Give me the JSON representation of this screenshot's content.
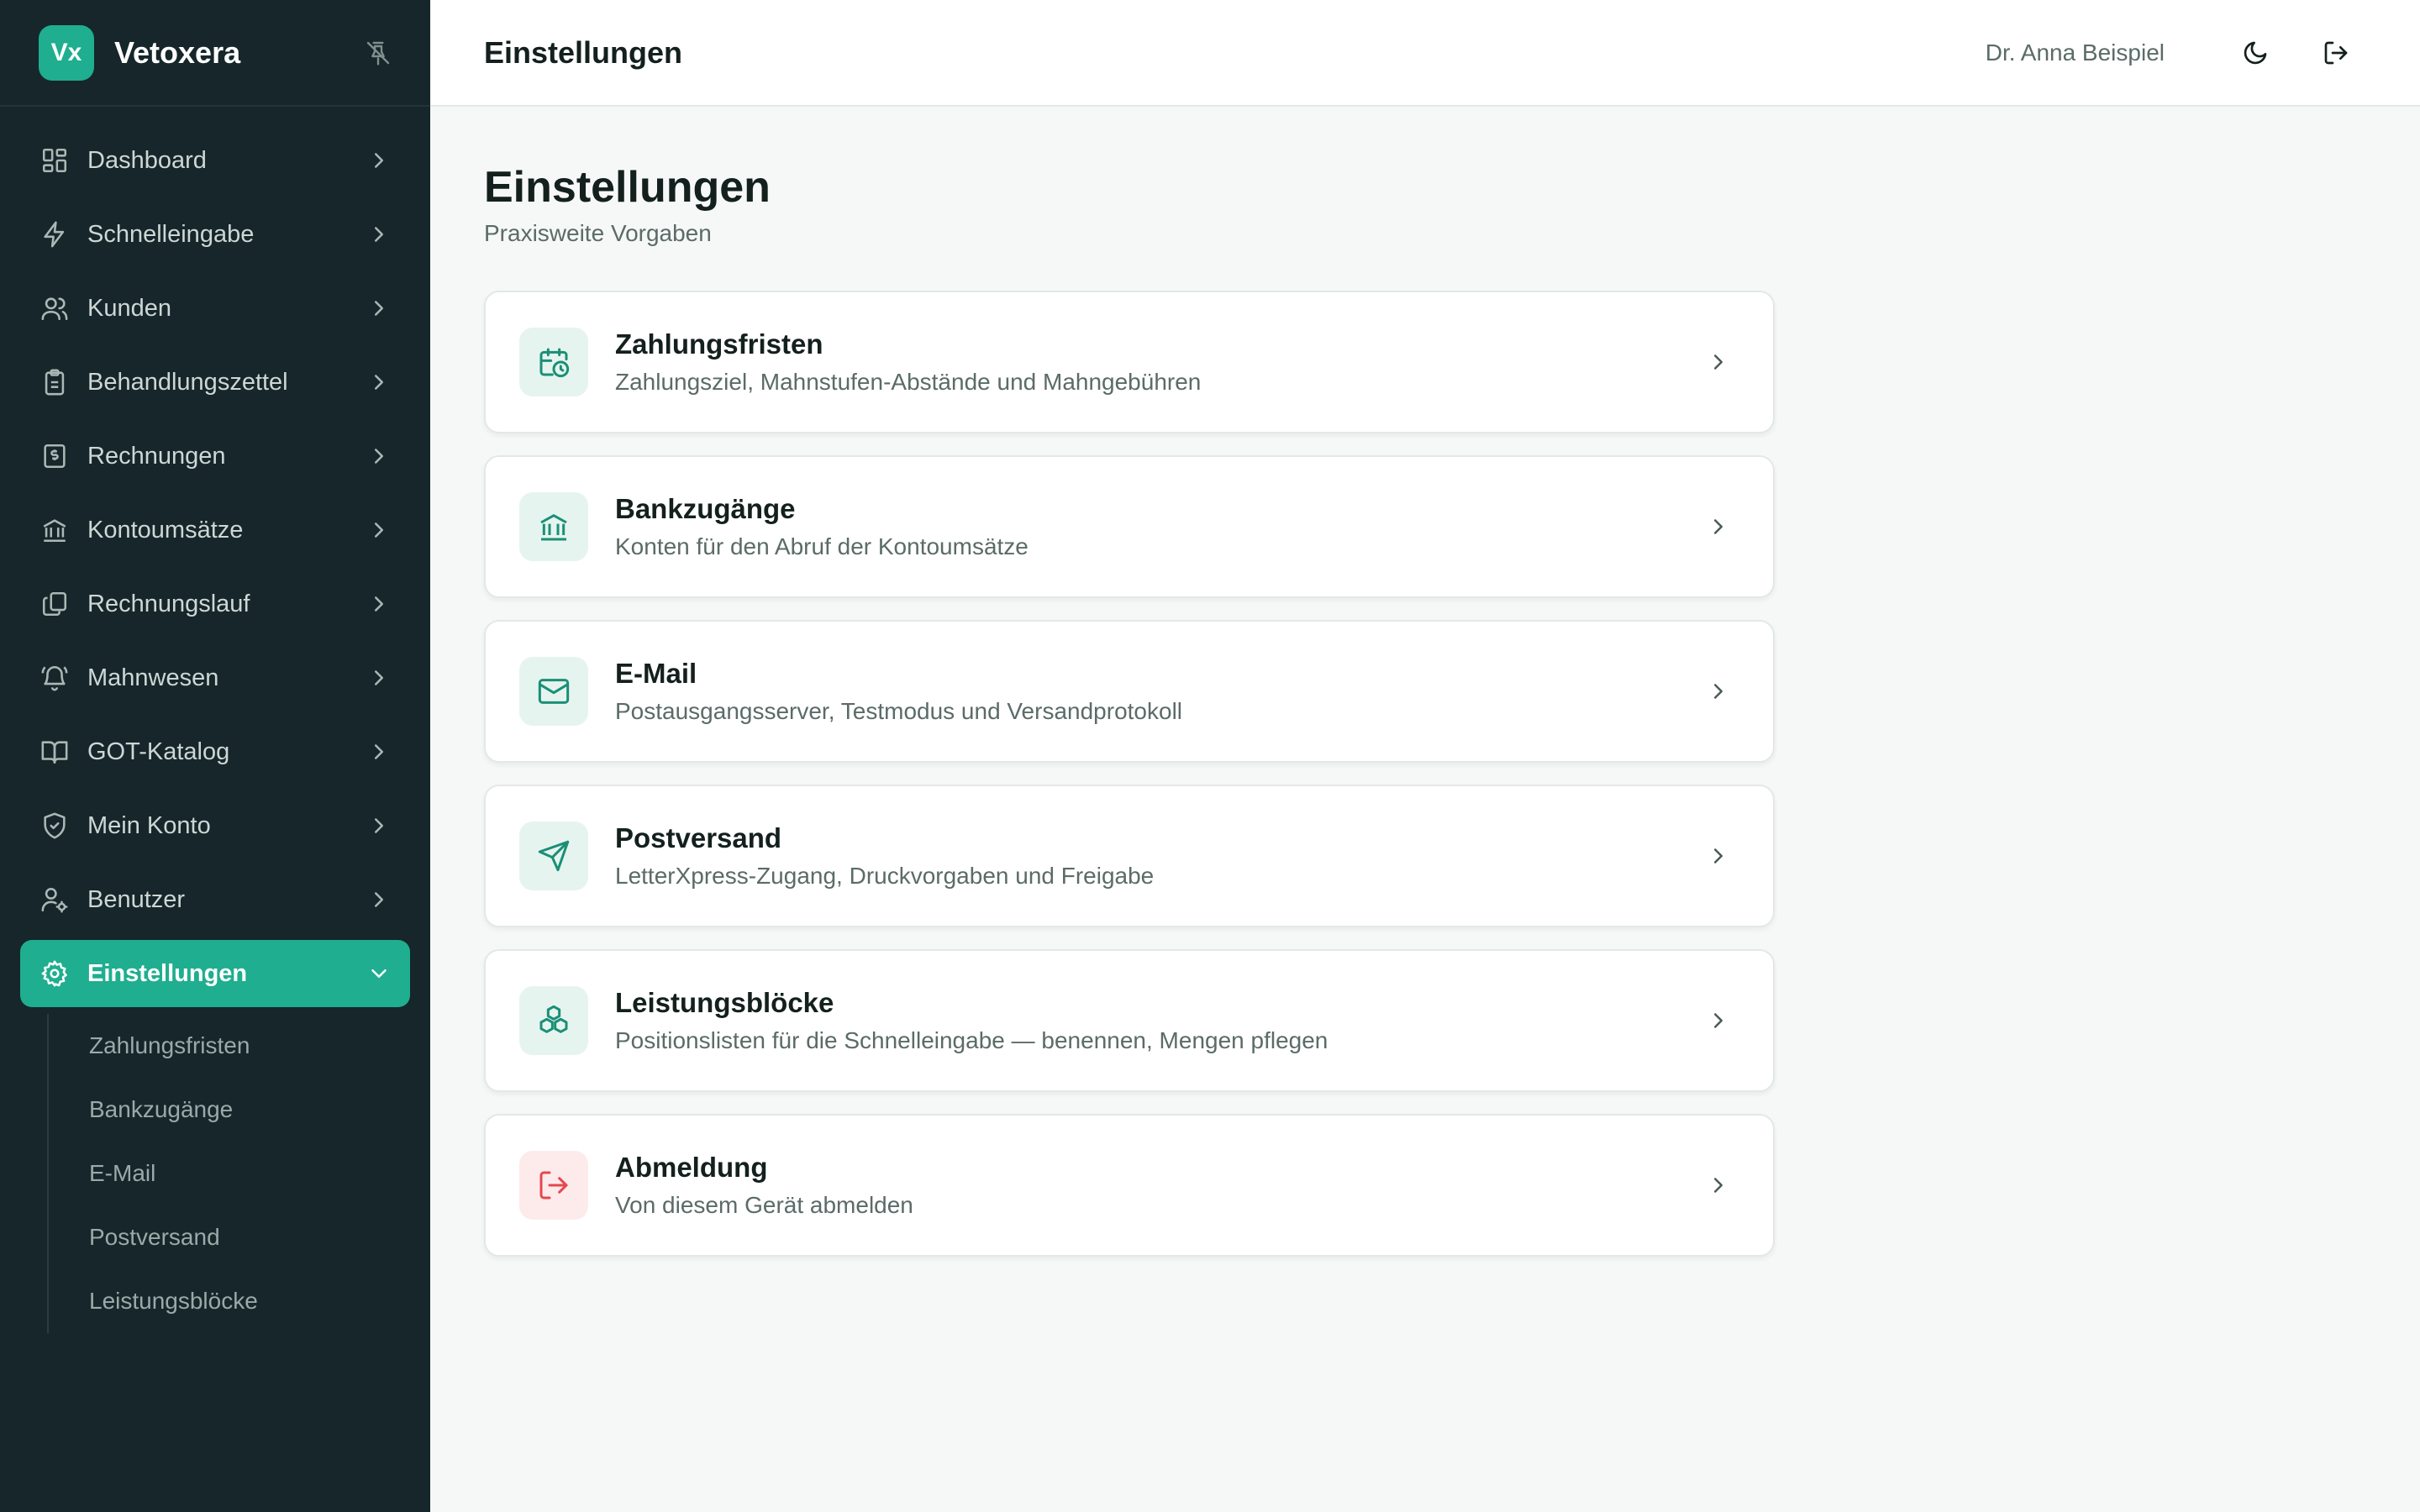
{
  "brand": {
    "logo_text": "Vx",
    "name": "Vetoxera"
  },
  "colors": {
    "sidebar_bg": "#16262a",
    "accent": "#1fae8f",
    "danger": "#e5484d"
  },
  "sidebar": {
    "items": [
      {
        "label": "Dashboard",
        "icon": "dashboard-icon"
      },
      {
        "label": "Schnelleingabe",
        "icon": "bolt-icon"
      },
      {
        "label": "Kunden",
        "icon": "users-icon"
      },
      {
        "label": "Behandlungszettel",
        "icon": "clipboard-icon"
      },
      {
        "label": "Rechnungen",
        "icon": "invoice-icon"
      },
      {
        "label": "Kontoumsätze",
        "icon": "bank-icon"
      },
      {
        "label": "Rechnungslauf",
        "icon": "copy-stack-icon"
      },
      {
        "label": "Mahnwesen",
        "icon": "bell-icon"
      },
      {
        "label": "GOT-Katalog",
        "icon": "book-icon"
      },
      {
        "label": "Mein Konto",
        "icon": "shield-icon"
      },
      {
        "label": "Benutzer",
        "icon": "user-gear-icon"
      },
      {
        "label": "Einstellungen",
        "icon": "gear-icon",
        "active": true
      }
    ],
    "sub_items": [
      "Zahlungsfristen",
      "Bankzugänge",
      "E-Mail",
      "Postversand",
      "Leistungsblöcke"
    ]
  },
  "header": {
    "title": "Einstellungen",
    "user_name": "Dr. Anna Beispiel"
  },
  "main": {
    "title": "Einstellungen",
    "subtitle": "Praxisweite Vorgaben",
    "cards": [
      {
        "title": "Zahlungsfristen",
        "description": "Zahlungsziel, Mahnstufen-Abstände und Mahngebühren",
        "icon": "calendar-clock-icon"
      },
      {
        "title": "Bankzugänge",
        "description": "Konten für den Abruf der Kontoumsätze",
        "icon": "bank-icon"
      },
      {
        "title": "E-Mail",
        "description": "Postausgangsserver, Testmodus und Versandprotokoll",
        "icon": "mail-icon"
      },
      {
        "title": "Postversand",
        "description": "LetterXpress-Zugang, Druckvorgaben und Freigabe",
        "icon": "send-icon"
      },
      {
        "title": "Leistungsblöcke",
        "description": "Positionslisten für die Schnelleingabe — benennen, Mengen pflegen",
        "icon": "blocks-icon"
      },
      {
        "title": "Abmeldung",
        "description": "Von diesem Gerät abmelden",
        "icon": "logout-icon"
      }
    ]
  }
}
